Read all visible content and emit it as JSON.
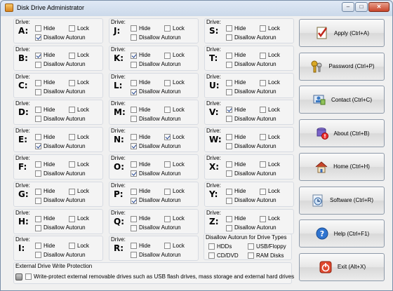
{
  "window": {
    "title": "Disk Drive Administrator",
    "minimize": "–",
    "maximize": "□",
    "close": "✕"
  },
  "labels": {
    "drive": "Drive:",
    "hide": "Hide",
    "lock": "Lock",
    "autorun": "Disallow Autorun"
  },
  "drives": [
    {
      "letter": "A:",
      "hide": false,
      "lock": false,
      "autorun": true
    },
    {
      "letter": "B:",
      "hide": true,
      "lock": false,
      "autorun": false
    },
    {
      "letter": "C:",
      "hide": false,
      "lock": false,
      "autorun": false
    },
    {
      "letter": "D:",
      "hide": false,
      "lock": false,
      "autorun": false
    },
    {
      "letter": "E:",
      "hide": false,
      "lock": false,
      "autorun": true
    },
    {
      "letter": "F:",
      "hide": false,
      "lock": false,
      "autorun": false
    },
    {
      "letter": "G:",
      "hide": false,
      "lock": false,
      "autorun": false
    },
    {
      "letter": "H:",
      "hide": false,
      "lock": false,
      "autorun": false
    },
    {
      "letter": "I:",
      "hide": false,
      "lock": false,
      "autorun": false
    },
    {
      "letter": "J:",
      "hide": false,
      "lock": false,
      "autorun": false
    },
    {
      "letter": "K:",
      "hide": true,
      "lock": false,
      "autorun": false
    },
    {
      "letter": "L:",
      "hide": false,
      "lock": false,
      "autorun": true
    },
    {
      "letter": "M:",
      "hide": false,
      "lock": false,
      "autorun": false
    },
    {
      "letter": "N:",
      "hide": false,
      "lock": true,
      "autorun": true
    },
    {
      "letter": "O:",
      "hide": false,
      "lock": false,
      "autorun": true
    },
    {
      "letter": "P:",
      "hide": false,
      "lock": false,
      "autorun": true
    },
    {
      "letter": "Q:",
      "hide": false,
      "lock": false,
      "autorun": false
    },
    {
      "letter": "R:",
      "hide": false,
      "lock": false,
      "autorun": false
    },
    {
      "letter": "S:",
      "hide": false,
      "lock": false,
      "autorun": false
    },
    {
      "letter": "T:",
      "hide": false,
      "lock": false,
      "autorun": false
    },
    {
      "letter": "U:",
      "hide": false,
      "lock": false,
      "autorun": false
    },
    {
      "letter": "V:",
      "hide": true,
      "lock": false,
      "autorun": false
    },
    {
      "letter": "W:",
      "hide": false,
      "lock": false,
      "autorun": false
    },
    {
      "letter": "X:",
      "hide": false,
      "lock": false,
      "autorun": false
    },
    {
      "letter": "Y:",
      "hide": false,
      "lock": false,
      "autorun": false
    },
    {
      "letter": "Z:",
      "hide": false,
      "lock": false,
      "autorun": false
    }
  ],
  "drive_types": {
    "caption": "Disallow Autorun for Drive Types",
    "items": [
      {
        "label": "HDDs",
        "checked": false
      },
      {
        "label": "USB/Floppy",
        "checked": false
      },
      {
        "label": "CD/DVD",
        "checked": false
      },
      {
        "label": "RAM Disks",
        "checked": false
      }
    ]
  },
  "write_protection": {
    "caption": "External Drive Write Protection",
    "label": "Write-protect external removable drives such as USB flash drives, mass storage and external hard drives",
    "checked": false
  },
  "buttons": [
    {
      "label": "Apply (Ctrl+A)",
      "icon": "checklist-icon"
    },
    {
      "label": "Password (Ctrl+P)",
      "icon": "keys-icon"
    },
    {
      "label": "Contact (Ctrl+C)",
      "icon": "contact-icon"
    },
    {
      "label": "About (Ctrl+B)",
      "icon": "about-icon"
    },
    {
      "label": "Home (Ctrl+H)",
      "icon": "home-icon"
    },
    {
      "label": "Software (Ctrl+R)",
      "icon": "software-icon"
    },
    {
      "label": "Help (Ctrl+F1)",
      "icon": "help-icon"
    },
    {
      "label": "Exit (Alt+X)",
      "icon": "exit-icon"
    }
  ]
}
